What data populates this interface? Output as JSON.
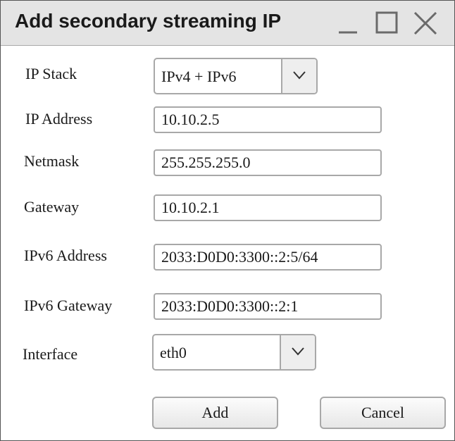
{
  "window": {
    "title": "Add secondary streaming IP",
    "controls": {
      "minimize_icon": "minimize-icon",
      "maximize_icon": "maximize-icon",
      "close_icon": "close-icon"
    }
  },
  "form": {
    "ip_stack": {
      "label": "IP Stack",
      "value": "IPv4 + IPv6"
    },
    "ip_address": {
      "label": "IP Address",
      "value": "10.10.2.5"
    },
    "netmask": {
      "label": "Netmask",
      "value": "255.255.255.0"
    },
    "gateway": {
      "label": "Gateway",
      "value": "10.10.2.1"
    },
    "ipv6_address": {
      "label": "IPv6 Address",
      "value": "2033:D0D0:3300::2:5/64"
    },
    "ipv6_gateway": {
      "label": "IPv6 Gateway",
      "value": "2033:D0D0:3300::2:1"
    },
    "interface": {
      "label": "Interface",
      "value": "eth0"
    }
  },
  "buttons": {
    "add": "Add",
    "cancel": "Cancel"
  },
  "colors": {
    "titlebar_bg": "#e4e4e4",
    "border": "#a8a8a8",
    "text": "#1a1a1a"
  }
}
